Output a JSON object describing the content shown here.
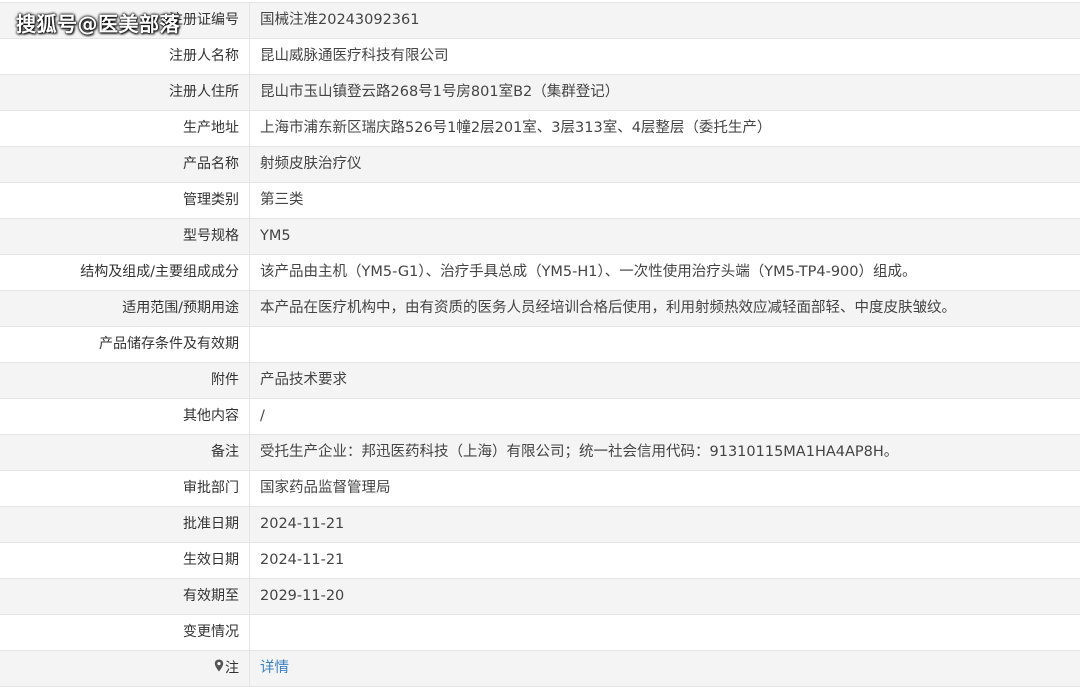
{
  "watermark": "搜狐号@医美部落",
  "rows": [
    {
      "label": "注册证编号",
      "value": "国械注准20243092361"
    },
    {
      "label": "注册人名称",
      "value": "昆山威脉通医疗科技有限公司"
    },
    {
      "label": "注册人住所",
      "value": "昆山市玉山镇登云路268号1号房801室B2（集群登记）"
    },
    {
      "label": "生产地址",
      "value": "上海市浦东新区瑞庆路526号1幢2层201室、3层313室、4层整层（委托生产）"
    },
    {
      "label": "产品名称",
      "value": "射频皮肤治疗仪"
    },
    {
      "label": "管理类别",
      "value": "第三类"
    },
    {
      "label": "型号规格",
      "value": "YM5"
    },
    {
      "label": "结构及组成/主要组成成分",
      "value": "该产品由主机（YM5-G1）、治疗手具总成（YM5-H1）、一次性使用治疗头端（YM5-TP4-900）组成。"
    },
    {
      "label": "适用范围/预期用途",
      "value": "本产品在医疗机构中，由有资质的医务人员经培训合格后使用，利用射频热效应减轻面部轻、中度皮肤皱纹。"
    },
    {
      "label": "产品储存条件及有效期",
      "value": ""
    },
    {
      "label": "附件",
      "value": "产品技术要求"
    },
    {
      "label": "其他内容",
      "value": "/"
    },
    {
      "label": "备注",
      "value": "受托生产企业：邦迅医药科技（上海）有限公司；统一社会信用代码：91310115MA1HA4AP8H。"
    },
    {
      "label": "审批部门",
      "value": "国家药品监督管理局"
    },
    {
      "label": "批准日期",
      "value": "2024-11-21"
    },
    {
      "label": "生效日期",
      "value": "2024-11-21"
    },
    {
      "label": "有效期至",
      "value": "2029-11-20"
    },
    {
      "label": "变更情况",
      "value": ""
    }
  ],
  "last_row": {
    "label": "注",
    "link": "详情",
    "icon": "pin-icon"
  }
}
